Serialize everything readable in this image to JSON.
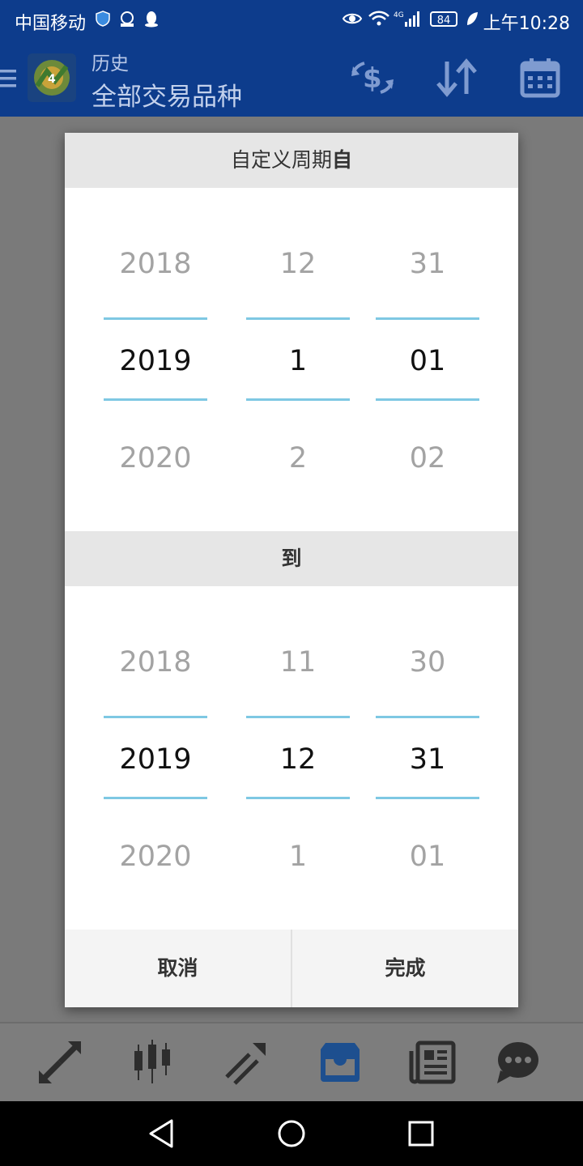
{
  "status_bar": {
    "carrier": "中国移动",
    "battery": "84",
    "time": "上午10:28"
  },
  "app_bar": {
    "title": "历史",
    "subtitle": "全部交易品种",
    "actions": [
      "currency-swap-icon",
      "sort-icon",
      "calendar-icon"
    ]
  },
  "dialog": {
    "header_from_prefix": "自定义周期",
    "header_from_bold": "自",
    "header_to": "到",
    "from": {
      "year": {
        "prev": "2018",
        "selected": "2019",
        "next": "2020"
      },
      "month": {
        "prev": "12",
        "selected": "1",
        "next": "2"
      },
      "day": {
        "prev": "31",
        "selected": "01",
        "next": "02"
      }
    },
    "to": {
      "year": {
        "prev": "2018",
        "selected": "2019",
        "next": "2020"
      },
      "month": {
        "prev": "11",
        "selected": "12",
        "next": "1"
      },
      "day": {
        "prev": "30",
        "selected": "31",
        "next": "01"
      }
    },
    "cancel_label": "取消",
    "done_label": "完成"
  },
  "tab_bar": {
    "tabs": [
      "quotes-icon",
      "chart-icon",
      "trade-icon",
      "history-icon",
      "news-icon",
      "chat-icon"
    ],
    "active_tab": "history-icon"
  },
  "colors": {
    "primary": "#0d3c8c",
    "picker_line": "#7ec8e3",
    "active_tab": "#1d4f8f"
  }
}
